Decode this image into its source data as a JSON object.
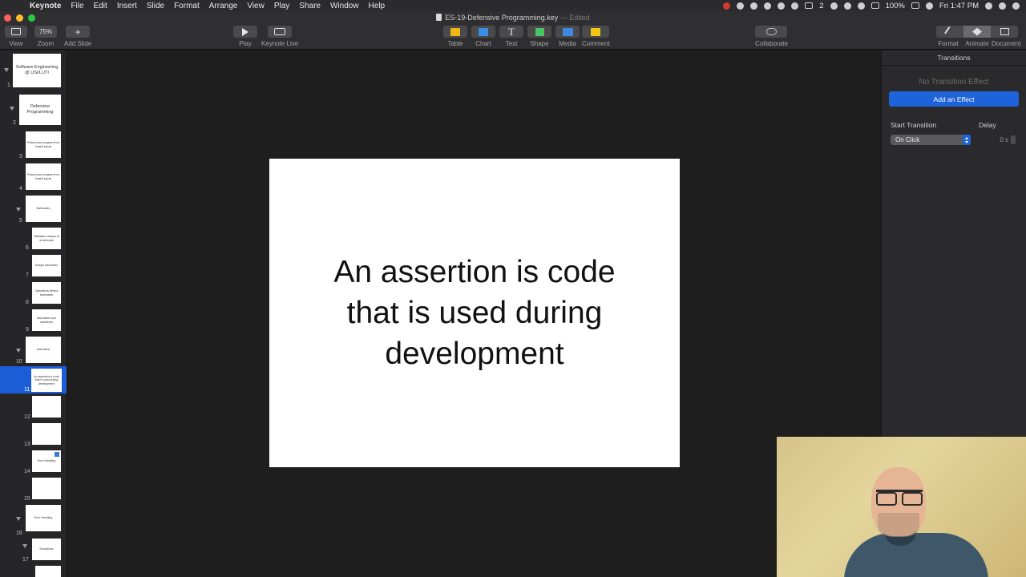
{
  "menubar": {
    "app": "Keynote",
    "items": [
      "File",
      "Edit",
      "Insert",
      "Slide",
      "Format",
      "Arrange",
      "View",
      "Play",
      "Share",
      "Window",
      "Help"
    ],
    "battery": "100%",
    "clock": "Fri 1:47 PM",
    "display_badge": "2"
  },
  "window": {
    "title": "ES-19-Defensive Programming.key",
    "edited": "— Edited"
  },
  "toolbar": {
    "view": "View",
    "zoom_value": "75%",
    "zoom": "Zoom",
    "add_slide": "Add Slide",
    "play": "Play",
    "keynote_live": "Keynote Live",
    "table": "Table",
    "chart": "Chart",
    "text": "Text",
    "shape": "Shape",
    "media": "Media",
    "comment": "Comment",
    "collaborate": "Collaborate",
    "format": "Format",
    "animate": "Animate",
    "document": "Document"
  },
  "navigator": {
    "slides": [
      {
        "num": "1",
        "text": "Software Engineering @ USI/LUTI",
        "big": true
      },
      {
        "num": "2",
        "text": "Defensive Programming",
        "big": true
      },
      {
        "num": "3",
        "text": "Protect your program from invalid inputs"
      },
      {
        "num": "4",
        "text": "Protect your program from invalid inputs"
      },
      {
        "num": "5",
        "text": "Barricades"
      },
      {
        "num": "6",
        "text": "Validation classes at a barricade"
      },
      {
        "num": "7",
        "text": "Design barricades"
      },
      {
        "num": "8",
        "text": "Operations behind barricades"
      },
      {
        "num": "9",
        "text": "Barricades and assertions"
      },
      {
        "num": "10",
        "text": "Assertions"
      },
      {
        "num": "11",
        "text": "An assertion is code that is used during development"
      },
      {
        "num": "12",
        "text": ""
      },
      {
        "num": "13",
        "text": ""
      },
      {
        "num": "14",
        "text": "Error Handling"
      },
      {
        "num": "15",
        "text": ""
      },
      {
        "num": "16",
        "text": "Error Handling"
      },
      {
        "num": "17",
        "text": "Exceptions"
      },
      {
        "num": "18",
        "text": ""
      }
    ]
  },
  "slide": {
    "text": "An assertion is code that is used during development"
  },
  "inspector": {
    "tab": "Transitions",
    "no_effect": "No Transition Effect",
    "add_effect": "Add an Effect",
    "start_transition_label": "Start Transition",
    "start_transition_value": "On Click",
    "delay_label": "Delay",
    "delay_value": "0 s"
  }
}
